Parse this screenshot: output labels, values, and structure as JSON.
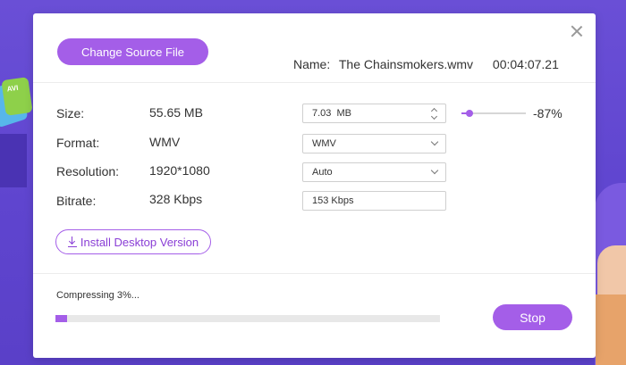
{
  "dialog": {
    "change_source_label": "Change Source File",
    "name_label": "Name:",
    "file_name": "The Chainsmokers.wmv",
    "duration": "00:04:07.21"
  },
  "rows": {
    "size": {
      "label": "Size:",
      "value": "55.65 MB",
      "target": "7.03  MB"
    },
    "format": {
      "label": "Format:",
      "value": "WMV",
      "target": "WMV"
    },
    "resolution": {
      "label": "Resolution:",
      "value": "1920*1080",
      "target": "Auto"
    },
    "bitrate": {
      "label": "Bitrate:",
      "value": "328  Kbps",
      "target": "153 Kbps"
    }
  },
  "slider": {
    "percent_label": "-87%",
    "level": 0.13
  },
  "install_label": "Install Desktop Version",
  "progress": {
    "status_text": "Compressing 3%...",
    "fraction": 0.03
  },
  "stop_label": "Stop",
  "colors": {
    "accent": "#a45ee8",
    "background": "#6a4fd6"
  },
  "icons": {
    "close": "close-icon",
    "download": "download-icon",
    "dropdown": "chevron-down-icon",
    "stepper": "stepper-icon"
  }
}
